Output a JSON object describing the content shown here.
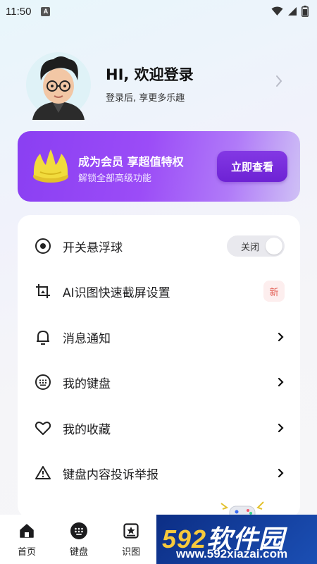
{
  "status_bar": {
    "time": "11:50",
    "indicator": "A",
    "icons": [
      "wifi-icon",
      "signal-icon",
      "battery-icon"
    ]
  },
  "profile": {
    "title": "HI, 欢迎登录",
    "subtitle": "登录后, 享更多乐趣"
  },
  "vip": {
    "title": "成为会员 享超值特权",
    "subtitle": "解锁全部高级功能",
    "button": "立即查看"
  },
  "settings": {
    "items": [
      {
        "label": "开关悬浮球",
        "icon": "floating-ball-icon",
        "right": "toggle",
        "toggle_text": "关闭",
        "toggle_on": false
      },
      {
        "label": "AI识图快速截屏设置",
        "icon": "crop-icon",
        "right": "badge",
        "badge": "新"
      },
      {
        "label": "消息通知",
        "icon": "bell-icon",
        "right": "chevron"
      },
      {
        "label": "我的键盘",
        "icon": "keyboard-icon",
        "right": "chevron"
      },
      {
        "label": "我的收藏",
        "icon": "heart-icon",
        "right": "chevron"
      },
      {
        "label": "键盘内容投诉举报",
        "icon": "warning-icon",
        "right": "chevron"
      }
    ]
  },
  "bottom_nav": {
    "items": [
      {
        "label": "首页",
        "icon": "home-icon"
      },
      {
        "label": "键盘",
        "icon": "keyboard-icon"
      },
      {
        "label": "识图",
        "icon": "image-recognition-icon"
      }
    ]
  },
  "watermark": {
    "brand_number": "592",
    "brand_text": "软件园",
    "url": "www.592xiazai.com"
  },
  "colors": {
    "vip_purple": "#8a3ff2",
    "vip_button": "#6d22d4",
    "badge_red": "#e25a50",
    "watermark_blue": "#1b4fb4",
    "watermark_yellow": "#f7c93c"
  }
}
